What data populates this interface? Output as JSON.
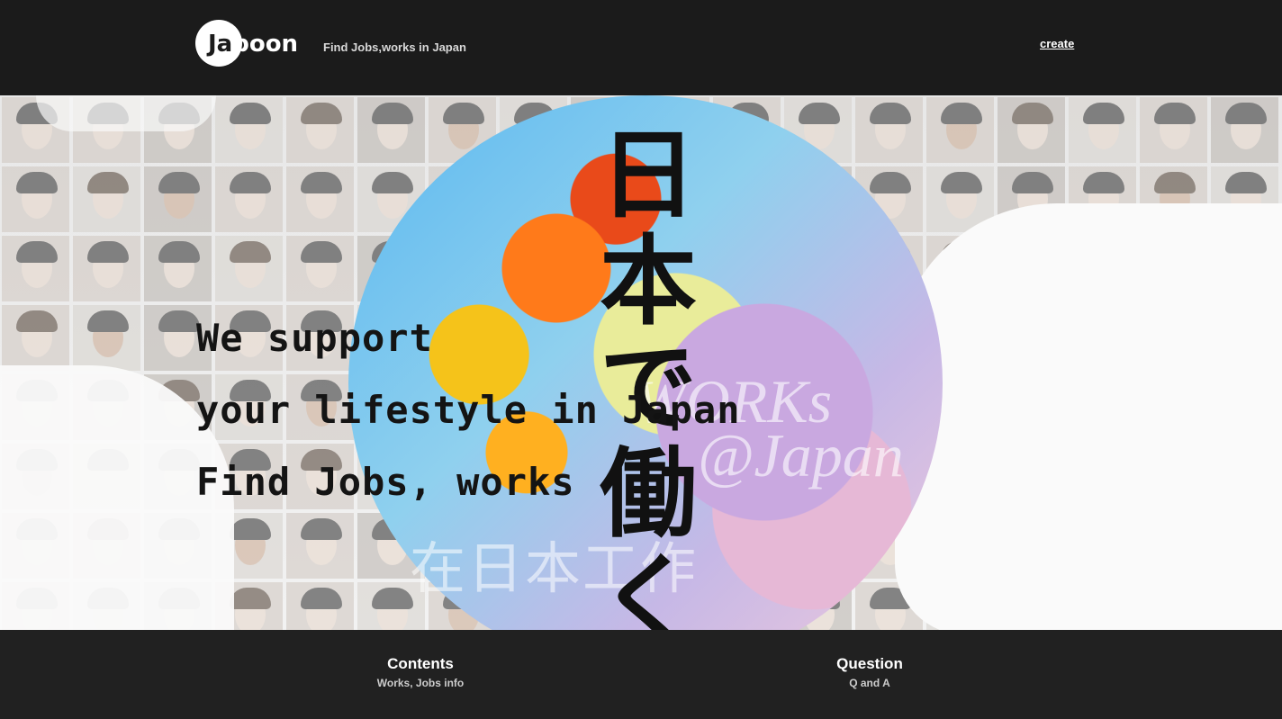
{
  "header": {
    "logo_text": "Jaboon",
    "tagline": "Find Jobs,works in Japan",
    "create_link": "create"
  },
  "hero": {
    "lines": [
      "We support",
      "your lifestyle in Japan",
      "Find Jobs, works"
    ],
    "kanji": "日本で働く",
    "watermark_en_1": "WORKs",
    "watermark_en_2": "@Japan",
    "watermark_zh": "在日本工作"
  },
  "footer": {
    "items": [
      {
        "title": "Contents",
        "subtitle": "Works, Jobs info"
      },
      {
        "title": "Question",
        "subtitle": "Q and A"
      }
    ]
  },
  "colors": {
    "header_bg": "#1b1b1b",
    "footer_bg": "#212121",
    "text_dark": "#141414",
    "text_light": "#ffffff"
  }
}
